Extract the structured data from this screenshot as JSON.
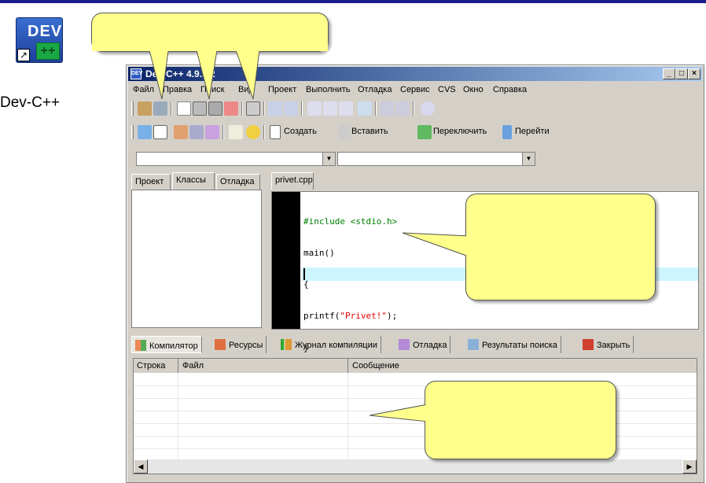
{
  "desktop_icon": {
    "label": "Dev-C++",
    "glyph_dev": "DEV",
    "glyph_pp": "++"
  },
  "window": {
    "title": "Dev-C++ 4.9.9.2",
    "controls": [
      "_",
      "□",
      "×"
    ]
  },
  "menu": [
    "Файл",
    "Правка",
    "Поиск",
    "Вид",
    "Проект",
    "Выполнить",
    "Отладка",
    "Сервис",
    "CVS",
    "Окно",
    "Справка"
  ],
  "toolbar2": {
    "create": "Создать",
    "insert": "Вставить",
    "switch": "Переключить",
    "goto": "Перейти"
  },
  "left_tabs": [
    "Проект",
    "Классы",
    "Отладка"
  ],
  "file_tab": "privet.cpp",
  "code": {
    "line1": "#include <stdio.h>",
    "line2": "main()",
    "line3": "{",
    "line4_pre": "printf(",
    "line4_str": "\"Privet!\"",
    "line4_post": ");",
    "line5": "}"
  },
  "bottom_tabs": [
    "Компилятор",
    "Ресурсы",
    "Журнал компиляции",
    "Отладка",
    "Результаты поиска",
    "Закрыть"
  ],
  "grid": {
    "columns": [
      "Строка",
      "Файл",
      "Сообщение"
    ]
  },
  "colors": {
    "callout": "#ffff8c",
    "titlebar": "#0a246a",
    "line_highlight": "#ccf5ff"
  }
}
